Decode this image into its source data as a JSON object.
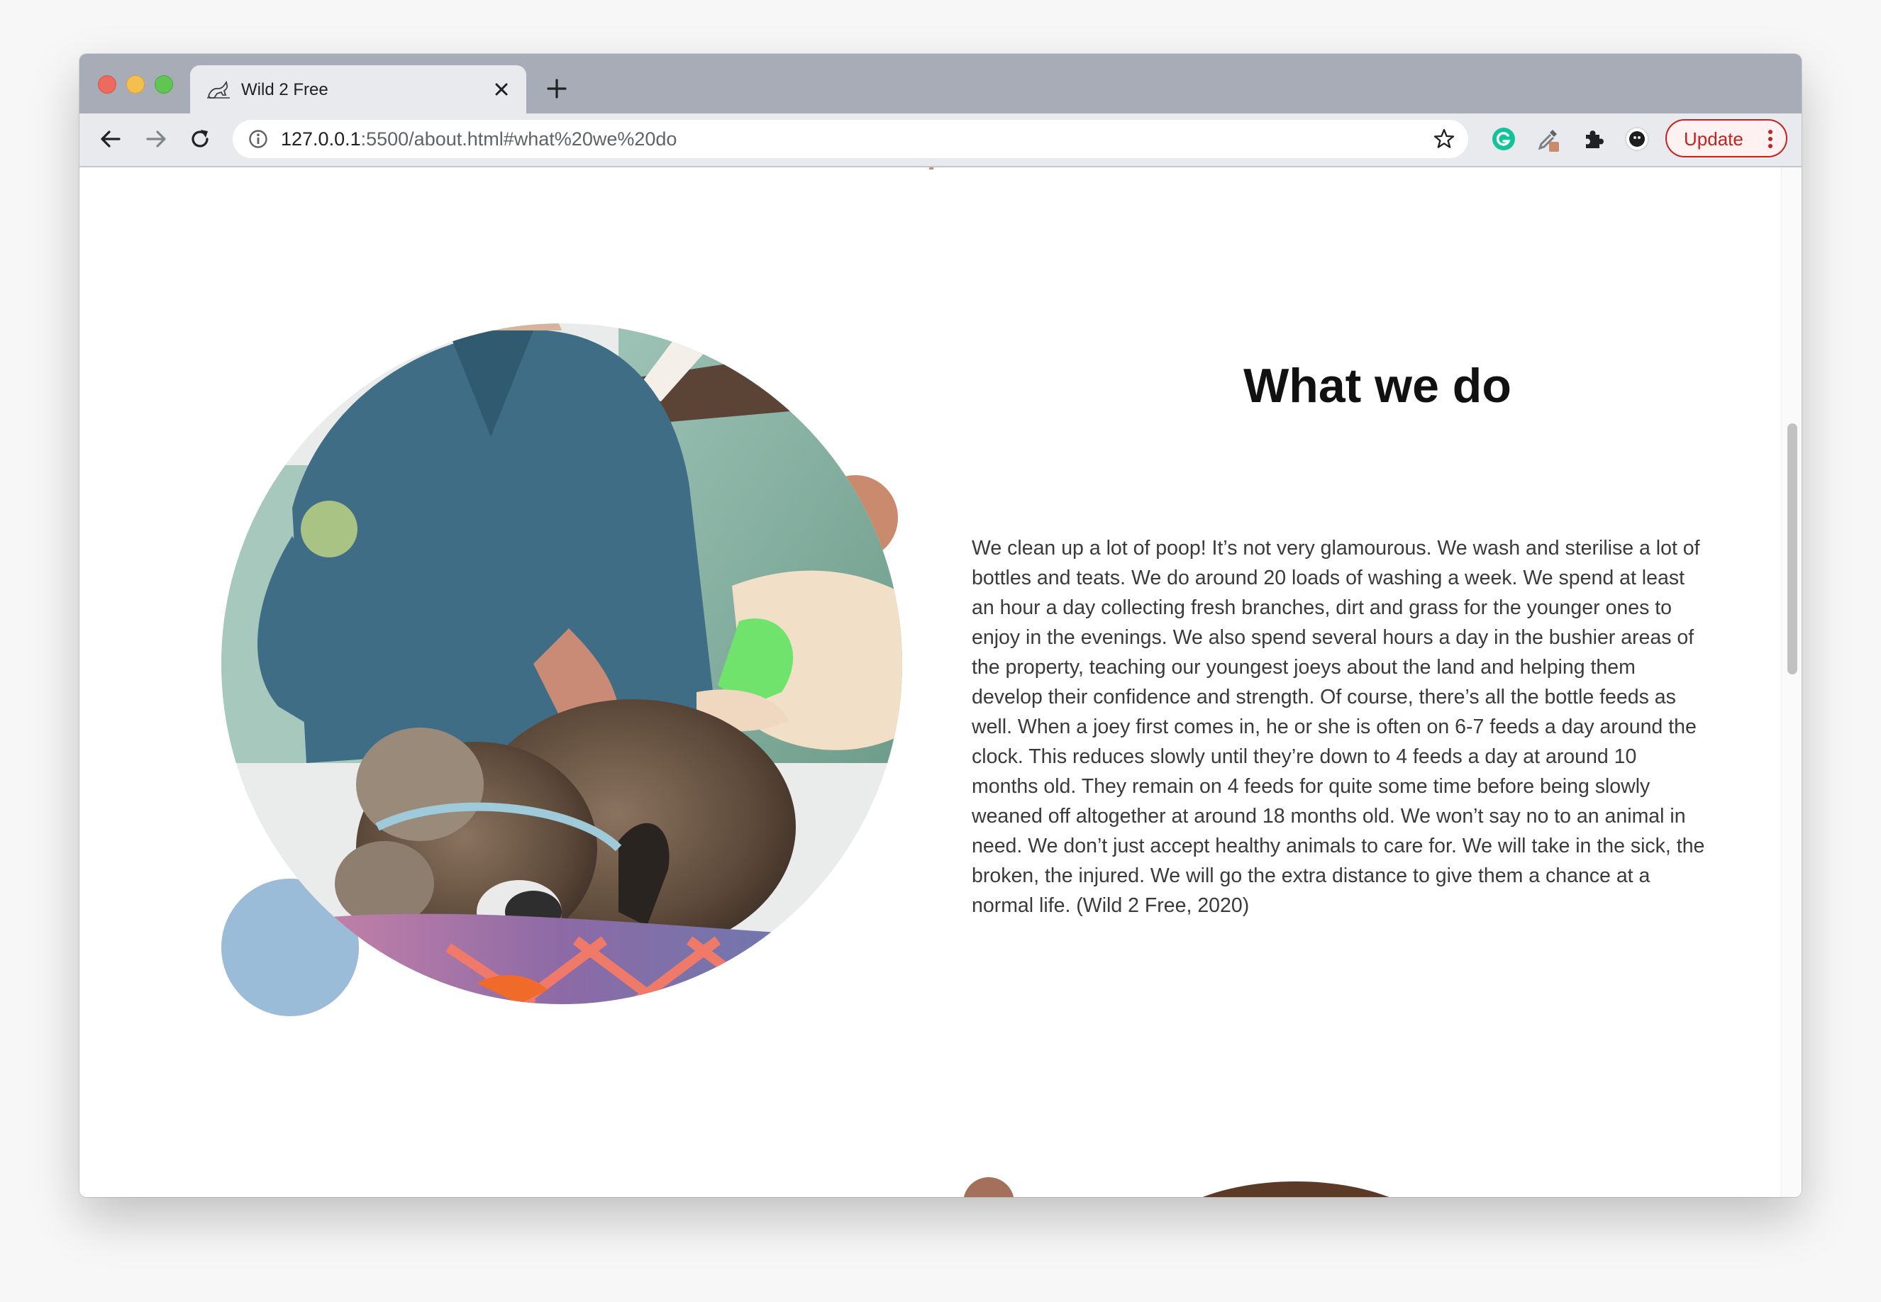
{
  "browser": {
    "tab_title": "Wild 2 Free",
    "url_host": "127.0.0.1",
    "url_rest": ":5500/about.html#what%20we%20do",
    "update_label": "Update",
    "icons": [
      "back-arrow-icon",
      "forward-arrow-icon",
      "reload-icon",
      "site-info-icon",
      "star-icon",
      "grammarly-icon",
      "eyedropper-extension-icon",
      "extensions-puzzle-icon",
      "profile-avatar-icon",
      "menu-dots-icon"
    ]
  },
  "content": {
    "heading": "What we do",
    "paragraph": "We clean up a lot of poop! It’s not very glamourous. We wash and sterilise a lot of bottles and teats. We do around 20 loads of washing a week. We spend at least an hour a day collecting fresh branches, dirt and grass for the younger ones to enjoy in the evenings. We also spend several hours a day in the bushier areas of the property, teaching our youngest joeys about the land and helping them develop their confidence and strength. Of course, there’s all the bottle feeds as well. When a joey first comes in, he or she is often on 6-7 feeds a day around the clock. This reduces slowly until they’re down to 4 feeds a day at around 10 months old. They remain on 4 feeds for quite some time before being slowly weaned off altogether at around 18 months old. We won’t say no to an animal in need. We don’t just accept healthy animals to care for. We will take in the sick, the broken, the injured. We will go the extra distance to give them a chance at a normal life. (Wild 2 Free, 2020)"
  },
  "colors": {
    "accent_green": "#a8c384",
    "accent_terracotta": "#c98a6e",
    "accent_blue": "#9bbcd8",
    "update_red": "#c5221f"
  }
}
